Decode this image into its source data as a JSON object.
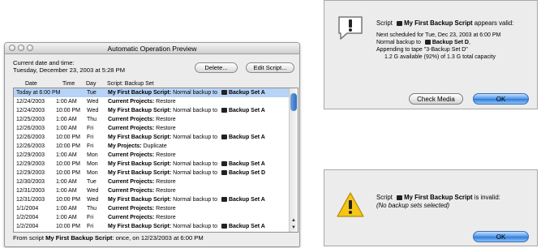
{
  "preview": {
    "title": "Automatic Operation Preview",
    "current_label": "Current date and time:",
    "current_value": "Tuesday, December 23, 2003 at 5:28 PM",
    "delete_button": "Delete...",
    "edit_button": "Edit Script...",
    "columns": {
      "date": "Date",
      "time": "Time",
      "day": "Day",
      "script": "Script: Backup Set"
    },
    "rows": [
      {
        "date": "Today at 6:00 PM",
        "time": "",
        "day": "Tue",
        "name": "My First Backup Script:",
        "desc": " Normal backup to ",
        "target": "Backup Set A",
        "disk": true,
        "selected": true
      },
      {
        "date": "12/24/2003",
        "time": "1:00 AM",
        "day": "Wed",
        "name": "Current Projects:",
        "desc": " Restore",
        "target": "",
        "disk": false
      },
      {
        "date": "12/24/2003",
        "time": "10:00 PM",
        "day": "Wed",
        "name": "My First Backup Script:",
        "desc": " Normal backup to ",
        "target": "Backup Set A",
        "disk": true
      },
      {
        "date": "12/25/2003",
        "time": "1:00 AM",
        "day": "Thu",
        "name": "Current Projects:",
        "desc": " Restore",
        "target": "",
        "disk": false
      },
      {
        "date": "12/26/2003",
        "time": "1:00 AM",
        "day": "Fri",
        "name": "Current Projects:",
        "desc": " Restore",
        "target": "",
        "disk": false
      },
      {
        "date": "12/26/2003",
        "time": "10:00 PM",
        "day": "Fri",
        "name": "My First Backup Script:",
        "desc": " Normal backup to ",
        "target": "Backup Set A",
        "disk": true
      },
      {
        "date": "12/26/2003",
        "time": "10:00 PM",
        "day": "Fri",
        "name": "My Projects:",
        "desc": " Duplicate",
        "target": "",
        "disk": false
      },
      {
        "date": "12/29/2003",
        "time": "1:00 AM",
        "day": "Mon",
        "name": "Current Projects:",
        "desc": " Restore",
        "target": "",
        "disk": false
      },
      {
        "date": "12/29/2003",
        "time": "10:00 PM",
        "day": "Mon",
        "name": "My First Backup Script:",
        "desc": " Normal backup to ",
        "target": "Backup Set A",
        "disk": true
      },
      {
        "date": "12/29/2003",
        "time": "10:00 PM",
        "day": "Mon",
        "name": "My First Backup Script:",
        "desc": " Normal backup to ",
        "target": "Backup Set D",
        "disk": true
      },
      {
        "date": "12/30/2003",
        "time": "1:00 AM",
        "day": "Tue",
        "name": "Current Projects:",
        "desc": " Restore",
        "target": "",
        "disk": false
      },
      {
        "date": "12/31/2003",
        "time": "1:00 AM",
        "day": "Wed",
        "name": "Current Projects:",
        "desc": " Restore",
        "target": "",
        "disk": false
      },
      {
        "date": "12/31/2003",
        "time": "10:00 PM",
        "day": "Wed",
        "name": "My First Backup Script:",
        "desc": " Normal backup to ",
        "target": "Backup Set A",
        "disk": true
      },
      {
        "date": "1/1/2004",
        "time": "1:00 AM",
        "day": "Thu",
        "name": "Current Projects:",
        "desc": " Restore",
        "target": "",
        "disk": false
      },
      {
        "date": "1/2/2004",
        "time": "1:00 AM",
        "day": "Fri",
        "name": "Current Projects:",
        "desc": " Restore",
        "target": "",
        "disk": false
      },
      {
        "date": "1/2/2004",
        "time": "10:00 PM",
        "day": "Fri",
        "name": "My First Backup Script:",
        "desc": " Normal backup to ",
        "target": "Backup Set A",
        "disk": true
      }
    ],
    "footer_prefix": "From script ",
    "footer_script": "My First Backup Script",
    "footer_suffix": ":  once, on 12/23/2003 at 6:00 PM"
  },
  "dialog_valid": {
    "line1_prefix": "Script ",
    "line1_script": "My First Backup Script",
    "line1_suffix": " appears valid:",
    "line2": "Next scheduled for Tue, Dec 23, 2003 at 6:00 PM",
    "line3_prefix": "Normal backup to ",
    "line3_target": "Backup Set D",
    "line3_suffix": ",",
    "line4": "Appending to tape \"3-Backup Set D\"",
    "line5": "1.2 G available (92%) of 1.3 G total capacity",
    "check_media_button": "Check Media",
    "ok_button": "OK"
  },
  "dialog_invalid": {
    "line1_prefix": "Script ",
    "line1_script": "My First Backup Script",
    "line1_suffix": " is invalid:",
    "line2": "(No backup sets selected)",
    "ok_button": "OK"
  },
  "colors": {
    "selection": "#b7d3f5",
    "default_button": "#3a86e0",
    "warning": "#f5c518"
  }
}
